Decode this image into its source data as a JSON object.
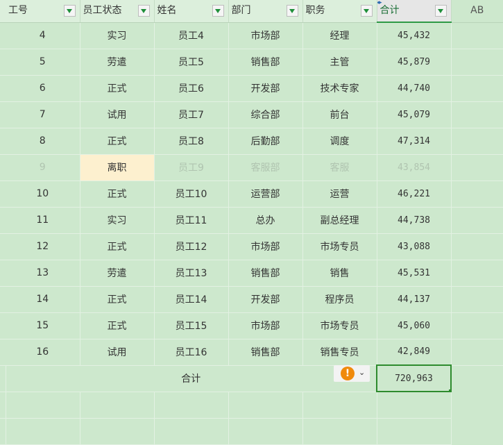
{
  "headers": [
    {
      "label": "工号",
      "filter": true
    },
    {
      "label": "员工状态",
      "filter": true
    },
    {
      "label": "姓名",
      "filter": true
    },
    {
      "label": "部门",
      "filter": true
    },
    {
      "label": "职务",
      "filter": true
    },
    {
      "label": "合计",
      "filter": true,
      "selected": true
    },
    {
      "label": "AB",
      "filter": false
    }
  ],
  "rows": [
    {
      "id": "4",
      "status": "实习",
      "name": "员工4",
      "dept": "市场部",
      "title": "经理",
      "total": "45,432"
    },
    {
      "id": "5",
      "status": "劳遣",
      "name": "员工5",
      "dept": "销售部",
      "title": "主管",
      "total": "45,879"
    },
    {
      "id": "6",
      "status": "正式",
      "name": "员工6",
      "dept": "开发部",
      "title": "技术专家",
      "total": "44,740"
    },
    {
      "id": "7",
      "status": "试用",
      "name": "员工7",
      "dept": "综合部",
      "title": "前台",
      "total": "45,079"
    },
    {
      "id": "8",
      "status": "正式",
      "name": "员工8",
      "dept": "后勤部",
      "title": "调度",
      "total": "47,314"
    },
    {
      "id": "9",
      "status": "离职",
      "name": "员工9",
      "dept": "客服部",
      "title": "客服",
      "total": "43,854",
      "dimmed": true
    },
    {
      "id": "10",
      "status": "正式",
      "name": "员工10",
      "dept": "运营部",
      "title": "运营",
      "total": "46,221"
    },
    {
      "id": "11",
      "status": "实习",
      "name": "员工11",
      "dept": "总办",
      "title": "副总经理",
      "total": "44,738"
    },
    {
      "id": "12",
      "status": "正式",
      "name": "员工12",
      "dept": "市场部",
      "title": "市场专员",
      "total": "43,088"
    },
    {
      "id": "13",
      "status": "劳遣",
      "name": "员工13",
      "dept": "销售部",
      "title": "销售",
      "total": "45,531"
    },
    {
      "id": "14",
      "status": "正式",
      "name": "员工14",
      "dept": "开发部",
      "title": "程序员",
      "total": "44,137"
    },
    {
      "id": "15",
      "status": "正式",
      "name": "员工15",
      "dept": "市场部",
      "title": "市场专员",
      "total": "45,060"
    },
    {
      "id": "16",
      "status": "试用",
      "name": "员工16",
      "dept": "销售部",
      "title": "销售专员",
      "total": "42,849"
    }
  ],
  "summary": {
    "label": "合计",
    "total": "720,963"
  },
  "smart_tag": {
    "icon": "warning-icon",
    "glyph": "!",
    "chevron": "⌄"
  },
  "colors": {
    "sheet_bg": "#cde8cd",
    "selection": "#2e8b2e",
    "warning": "#f08a0c",
    "dimmed_status_bg": "#fdf0cf"
  }
}
